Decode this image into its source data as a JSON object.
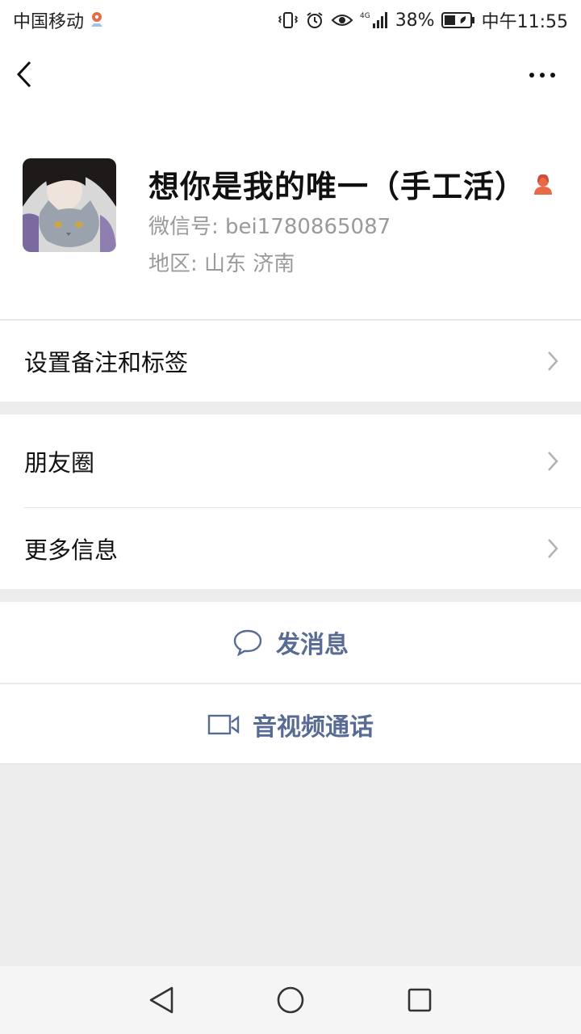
{
  "status_bar": {
    "carrier": "中国移动",
    "network": "4G",
    "battery": "38%",
    "time": "中午11:55"
  },
  "profile": {
    "nickname": "想你是我的唯一（手工活）",
    "wechat_id": "微信号: bei1780865087",
    "region": "地区: 山东  济南"
  },
  "menu": {
    "set_remark": "设置备注和标签",
    "moments": "朋友圈",
    "more_info": "更多信息"
  },
  "actions": {
    "send_message": "发消息",
    "video_call": "音视频通话"
  },
  "colors": {
    "link": "#576b95",
    "gender_female": "#e8694a"
  }
}
